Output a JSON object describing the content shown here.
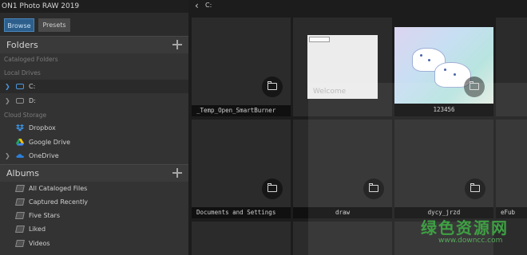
{
  "app": {
    "title": "ON1 Photo RAW 2019"
  },
  "tabs": {
    "browse": "Browse",
    "presets": "Presets"
  },
  "folders_panel": {
    "title": "Folders",
    "cataloged_label": "Cataloged Folders",
    "local_label": "Local Drives",
    "drives": [
      {
        "name": "C:",
        "selected": true
      },
      {
        "name": "D:",
        "selected": false
      }
    ],
    "cloud_label": "Cloud Storage",
    "cloud": [
      {
        "name": "Dropbox",
        "icon": "dropbox-icon"
      },
      {
        "name": "Google Drive",
        "icon": "google-drive-icon"
      },
      {
        "name": "OneDrive",
        "icon": "onedrive-icon"
      }
    ]
  },
  "albums_panel": {
    "title": "Albums",
    "items": [
      "All Cataloged Files",
      "Captured Recently",
      "Five Stars",
      "Liked",
      "Videos"
    ]
  },
  "breadcrumb": {
    "path": "C:"
  },
  "grid": {
    "items": [
      {
        "label": "_Temp_Open_SmartBurner",
        "kind": "folder"
      },
      {
        "label": "",
        "kind": "file",
        "preview_text": "Welcome"
      },
      {
        "label": "123456",
        "kind": "folder-photo"
      },
      {
        "label": "Documents and Settings",
        "kind": "folder"
      },
      {
        "label": "draw",
        "kind": "folder"
      },
      {
        "label": "dycy_jrzd",
        "kind": "folder"
      },
      {
        "label": "eFub",
        "kind": "folder"
      }
    ]
  },
  "watermark": {
    "text": "绿色资源网",
    "url": "www.downcc.com"
  },
  "colors": {
    "accent": "#4b97dd",
    "browse_tab": "#2d5f8c",
    "watermark_green": "#3ea043"
  }
}
